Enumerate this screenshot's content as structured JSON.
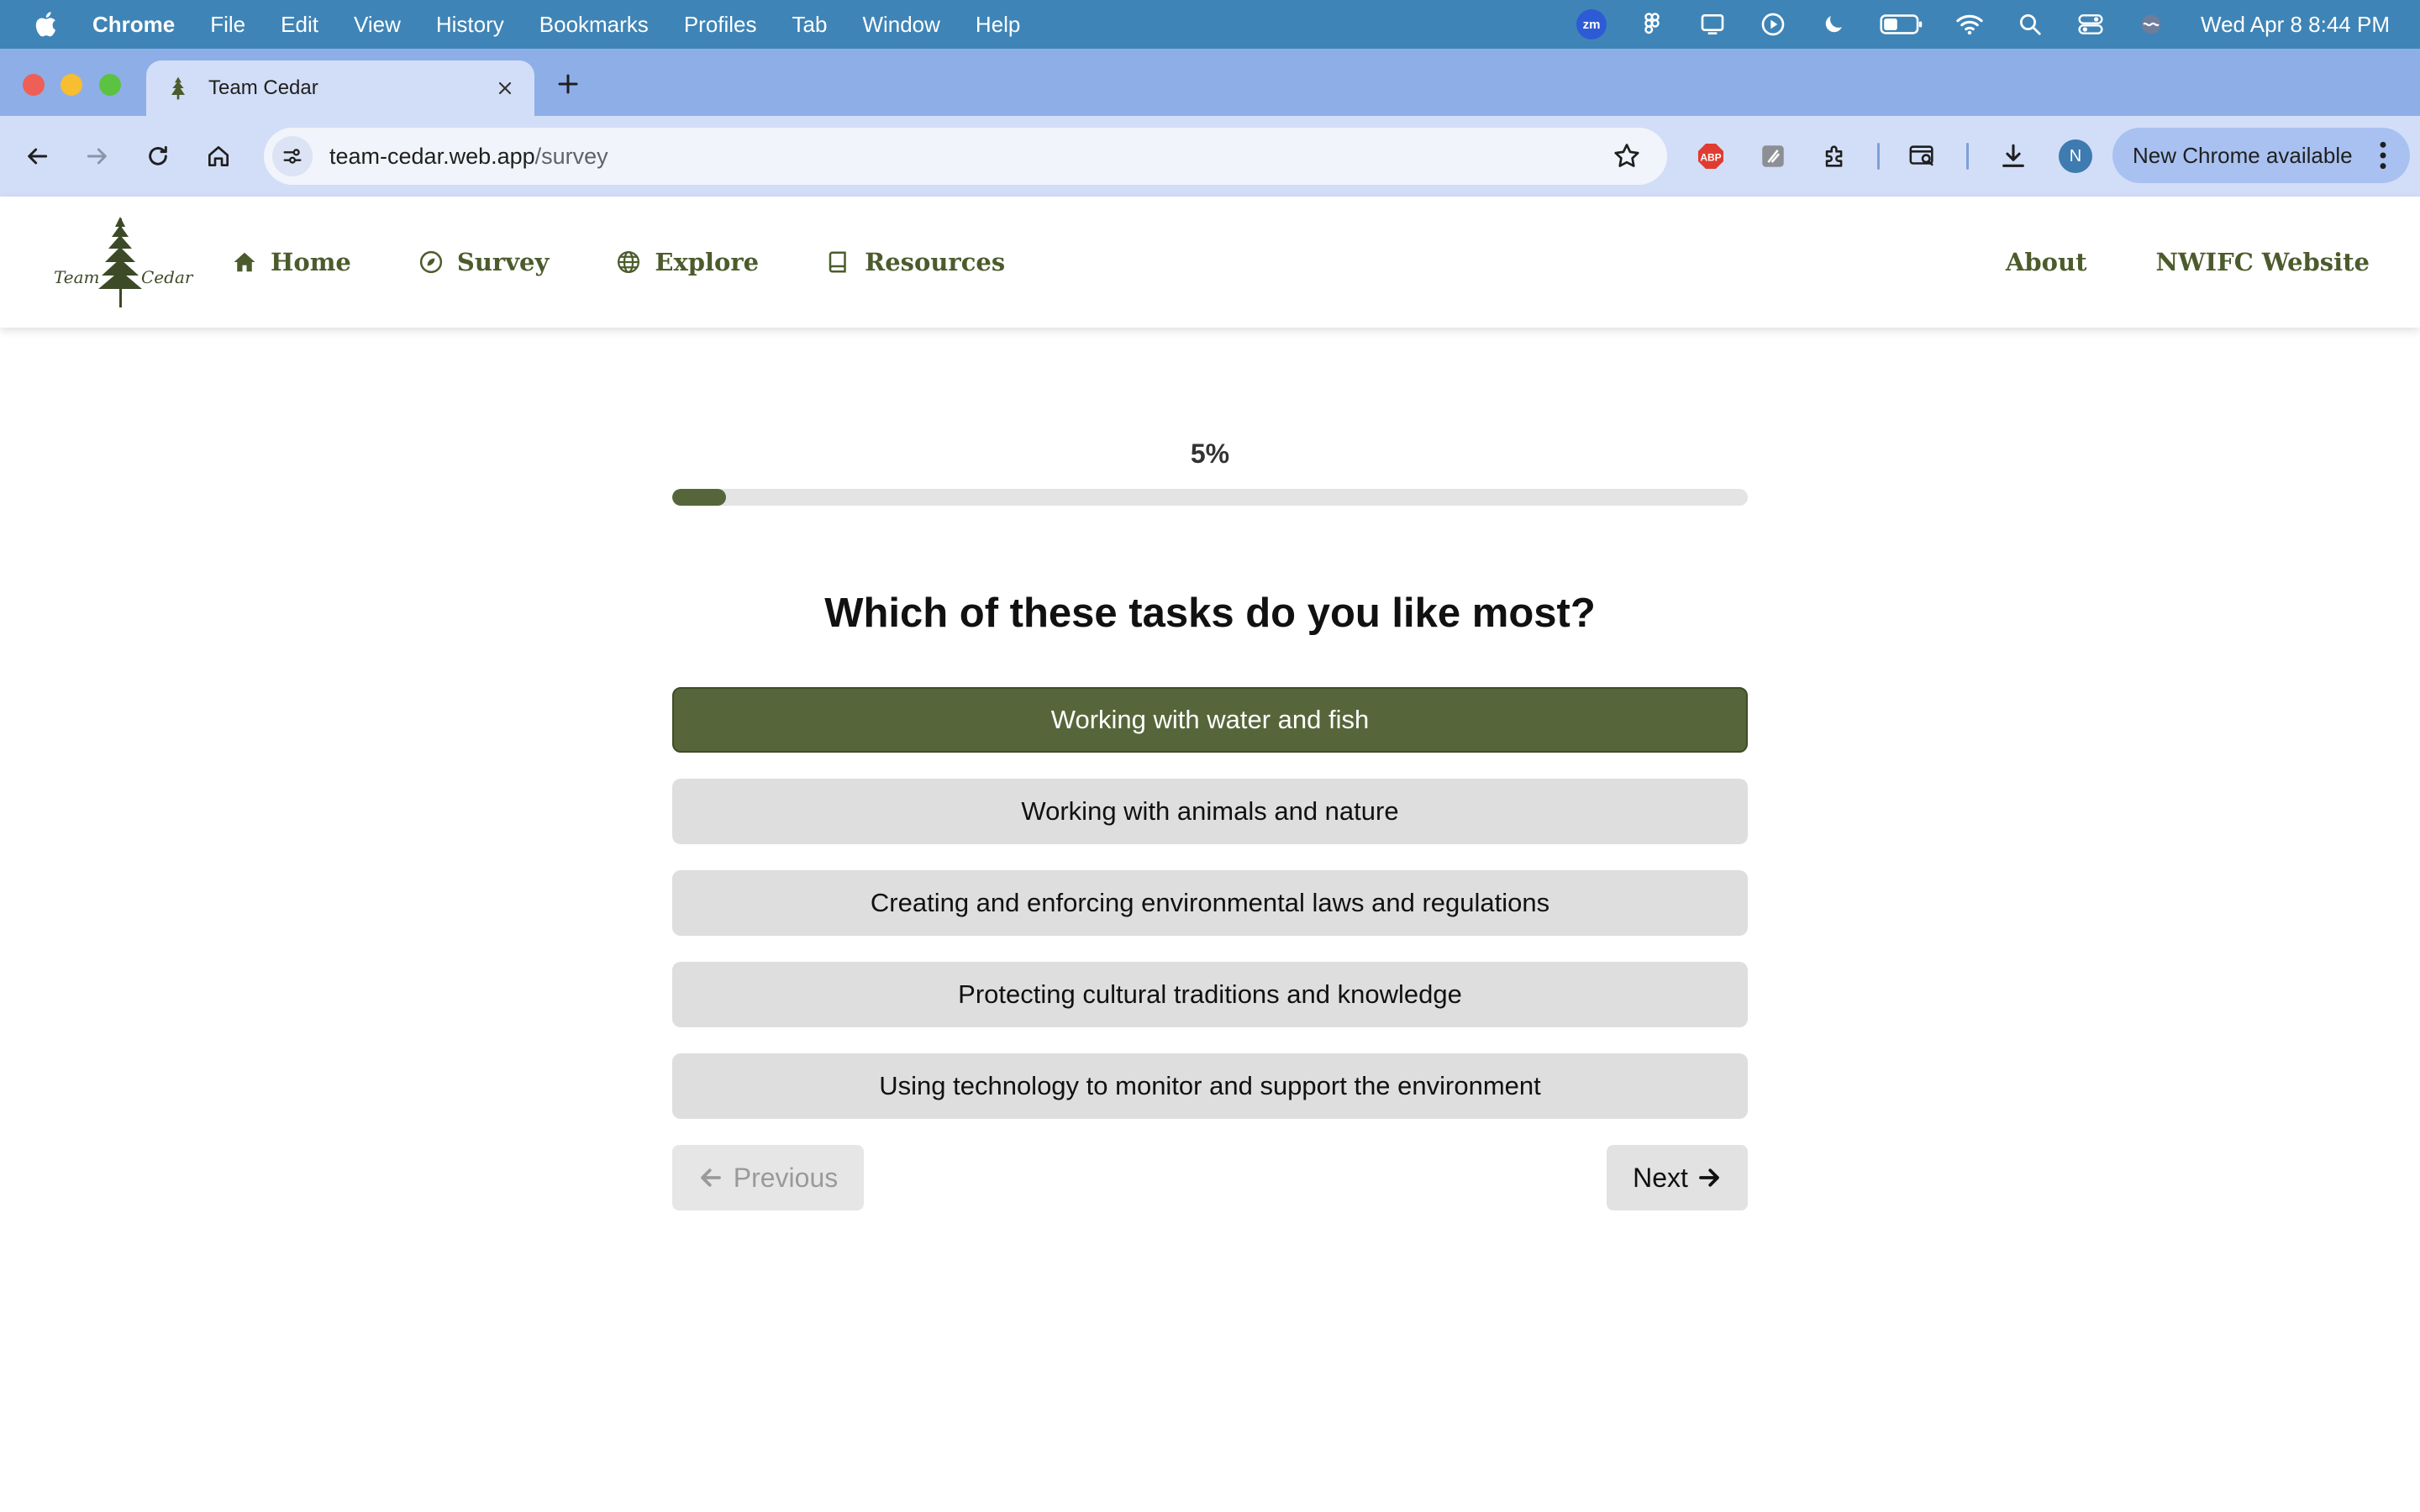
{
  "menubar": {
    "app": "Chrome",
    "items": [
      "File",
      "Edit",
      "View",
      "History",
      "Bookmarks",
      "Profiles",
      "Tab",
      "Window",
      "Help"
    ],
    "zoom_badge": "zm",
    "clock": "Wed Apr 8  8:44 PM"
  },
  "browser": {
    "tab_title": "Team Cedar",
    "url_host": "team-cedar.web.app",
    "url_path": "/survey",
    "profile_initial": "N",
    "update_label": "New Chrome available",
    "extension_abp": "ABP"
  },
  "site": {
    "logo_left": "Team",
    "logo_right": "Cedar",
    "nav": {
      "home": "Home",
      "survey": "Survey",
      "explore": "Explore",
      "resources": "Resources",
      "about": "About",
      "nwifc": "NWIFC Website"
    }
  },
  "survey": {
    "progress_label": "5%",
    "progress_value": 5,
    "question": "Which of these tasks do you like most?",
    "options": [
      "Working with water and fish",
      "Working with animals and nature",
      "Creating and enforcing environmental laws and regulations",
      "Protecting cultural traditions and knowledge",
      "Using technology to monitor and support the environment"
    ],
    "selected_index": 0,
    "previous_label": "Previous",
    "next_label": "Next"
  },
  "colors": {
    "accent": "#56663a",
    "nav_text": "#4c5b2c",
    "menubar": "#3f84b6",
    "tabstrip": "#8eaee8"
  }
}
